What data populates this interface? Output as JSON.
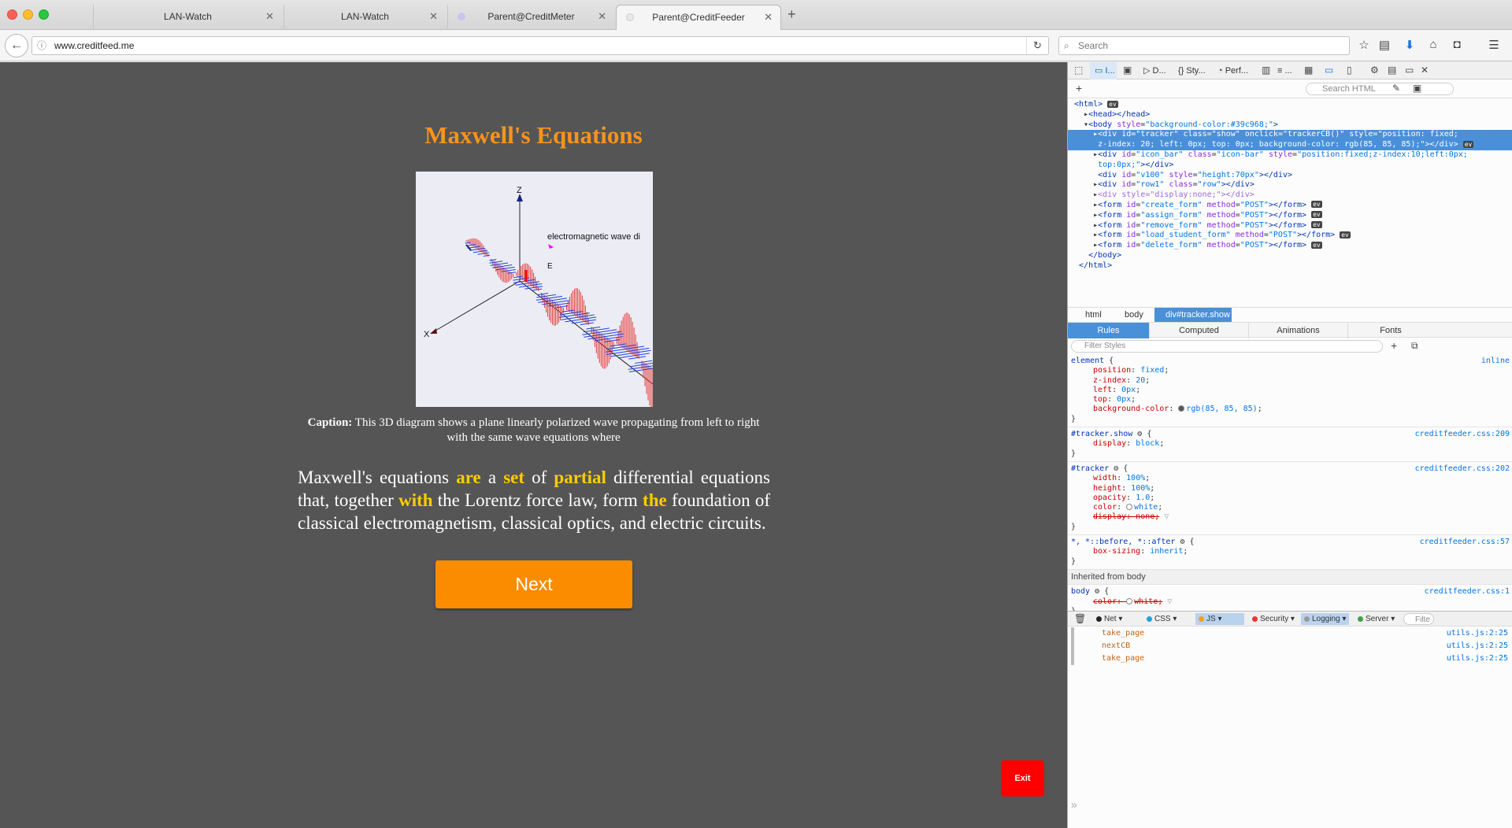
{
  "browser": {
    "tabs": [
      {
        "label": "LAN-Watch"
      },
      {
        "label": "LAN-Watch"
      },
      {
        "label": "Parent@CreditMeter"
      },
      {
        "label": "Parent@CreditFeeder"
      }
    ],
    "url": "www.creditfeed.me",
    "search_placeholder": "Search"
  },
  "page": {
    "title": "Maxwell's Equations",
    "diagram": {
      "axis_z": "Z",
      "axis_x": "X",
      "label_e": "E",
      "wave_label": "electromagnetic wave di"
    },
    "caption_bold": "Caption:",
    "caption_text": " This 3D diagram shows a plane linearly polarized wave propagating from left to right with the same wave equations where",
    "paragraph": [
      {
        "text": "Maxwell's equations ",
        "hl": false
      },
      {
        "text": "are",
        "hl": true
      },
      {
        "text": " a ",
        "hl": false
      },
      {
        "text": "set",
        "hl": true
      },
      {
        "text": " of ",
        "hl": false
      },
      {
        "text": "partial",
        "hl": true
      },
      {
        "text": " differential equations that, together ",
        "hl": false
      },
      {
        "text": "with",
        "hl": true
      },
      {
        "text": " the Lorentz force law, form ",
        "hl": false
      },
      {
        "text": "the",
        "hl": true
      },
      {
        "text": " foundation of classical electromagnetism, classical optics, and electric circuits.",
        "hl": false
      }
    ],
    "next_label": "Next",
    "exit_label": "Exit",
    "colors": {
      "title": "#f7931e",
      "highlight": "#ffcc00",
      "next": "#fb8c00",
      "exit": "#ff0000",
      "background": "#555555"
    }
  },
  "devtools": {
    "tabs": [
      "I...",
      "D...",
      "Sty...",
      "Perf...",
      "..."
    ],
    "search_html_placeholder": "Search HTML",
    "breadcrumbs": [
      "html",
      "body",
      "div#tracker.show"
    ],
    "rule_tabs": [
      "Rules",
      "Computed",
      "Animations",
      "Fonts"
    ],
    "filter_placeholder": "Filter Styles",
    "inherited_header": "Inherited from body",
    "console_tabs": [
      "Net",
      "CSS",
      "JS",
      "Security",
      "Logging",
      "Server",
      "Filte"
    ],
    "console_logs": [
      {
        "msg": "take_page",
        "src": "utils.js:2:25"
      },
      {
        "msg": "nextCB",
        "src": "utils.js:2:25"
      },
      {
        "msg": "take_page",
        "src": "utils.js:2:25"
      }
    ]
  }
}
